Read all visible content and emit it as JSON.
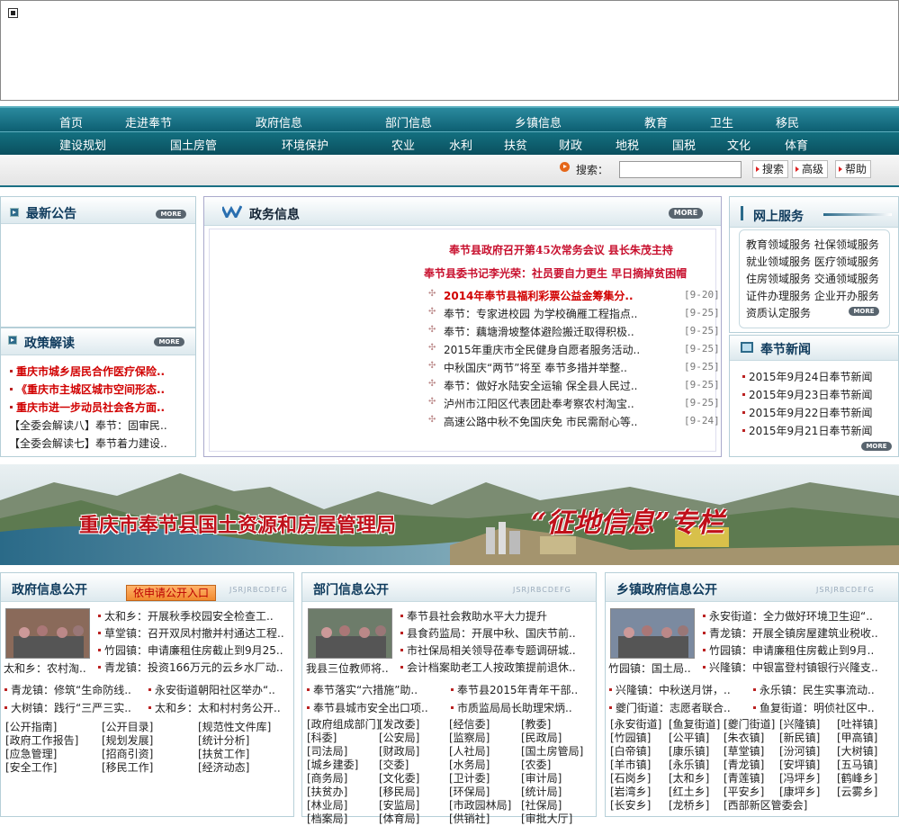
{
  "nav_primary": [
    "首页",
    "走进奉节",
    "政府信息",
    "部门信息",
    "乡镇信息",
    "教育",
    "卫生",
    "移民"
  ],
  "nav_secondary": [
    "建设规划",
    "国土房管",
    "环境保护",
    "农业",
    "水利",
    "扶贫",
    "财政",
    "地税",
    "国税",
    "文化",
    "体育"
  ],
  "search": {
    "label": "搜索：",
    "value": "",
    "buttons": [
      "搜索",
      "高级",
      "帮助"
    ]
  },
  "notice": {
    "title": "最新公告",
    "more": "MORE"
  },
  "policy": {
    "title": "政策解读",
    "more": "MORE",
    "items": [
      "重庆市城乡居民合作医疗保险..",
      "《重庆市主城区城市空间形态..",
      "重庆市进一步动员社会各方面..",
      "【全委会解读八】奉节：固审民..",
      "【全委会解读七】奉节着力建设.."
    ]
  },
  "gov": {
    "title": "政务信息",
    "more": "MORE",
    "headline1": "奉节县政府召开第45次常务会议  县长朱茂主持",
    "headline2": "奉节县委书记李光荣：社员要自力更生  早日摘掉贫困帽",
    "items": [
      {
        "t": "2014年奉节县福利彩票公益金筹集分..",
        "d": "[9-20]",
        "hot": true
      },
      {
        "t": "奉节：专家进校园 为学校确雁工程指点..",
        "d": "[9-25]"
      },
      {
        "t": "奉节：藕塘滑坡整体避险搬迁取得积极..",
        "d": "[9-25]"
      },
      {
        "t": "2015年重庆市全民健身自愿者服务活动..",
        "d": "[9-25]"
      },
      {
        "t": "中秋国庆“两节”将至 奉节多措并举整..",
        "d": "[9-25]"
      },
      {
        "t": "奉节：做好水陆安全运输 保全县人民过..",
        "d": "[9-25]"
      },
      {
        "t": "泸州市江阳区代表团赴奉考察农村淘宝..",
        "d": "[9-25]"
      },
      {
        "t": "高速公路中秋不免国庆免 市民需耐心等..",
        "d": "[9-24]"
      }
    ]
  },
  "online": {
    "title": "网上服务",
    "more": "MORE",
    "rows": [
      "教育领域服务 社保领域服务",
      "就业领域服务 医疗领域服务",
      "住房领域服务 交通领域服务",
      "证件办理服务 企业开办服务",
      "资质认定服务"
    ]
  },
  "news": {
    "title": "奉节新闻",
    "more": "MORE",
    "items": [
      "2015年9月24日奉节新闻",
      "2015年9月23日奉节新闻",
      "2015年9月22日奉节新闻",
      "2015年9月21日奉节新闻"
    ]
  },
  "banner": {
    "title": "重庆市奉节县国土资源和房屋管理局",
    "slogan": "“征地信息”专栏"
  },
  "pub1": {
    "title": "政府信息公开",
    "tab": "依申请公开入口",
    "wm": "JSRJRBCDEFG",
    "caption": "太和乡：农村淘..",
    "right": [
      "太和乡：开展秋季校园安全检查工..",
      "草堂镇：召开双凤村撤并村通达工程..",
      "竹园镇：申请廉租住房截止到9月25..",
      "青龙镇：投资166万元的云乡水厂动.."
    ],
    "row": [
      [
        "青龙镇：修筑“生命防线..",
        "永安街道朝阳社区举办“.."
      ],
      [
        "大树镇：践行“三严三实..",
        "太和乡：太和村村务公开.."
      ]
    ],
    "links": [
      "[公开指南]",
      "[公开目录]",
      "[规范性文件库]",
      "[政府工作报告]",
      "[规划发展]",
      "[统计分析]",
      "[应急管理]",
      "[招商引资]",
      "[扶贫工作]",
      "[安全工作]",
      "[移民工作]",
      "[经济动态]"
    ]
  },
  "pub2": {
    "title": "部门信息公开",
    "wm": "JSRJRBCDEFG",
    "caption": "我县三位教师将..",
    "right": [
      "奉节县社会救助水平大力提升",
      "县食药监局：开展中秋、国庆节前..",
      "市社保局相关领导莅奉专题调研城..",
      "会计档案助老工人按政策提前退休.."
    ],
    "row": [
      [
        "奉节落实“六措施”助..",
        "奉节县2015年青年干部.."
      ],
      [
        "奉节县城市安全出口项..",
        "市质监局局长助理宋炳.."
      ]
    ],
    "links": [
      "[政府组成部门]",
      "[发改委]",
      "[经信委]",
      "[教委]",
      "[科委]",
      "[公安局]",
      "[监察局]",
      "[民政局]",
      "[司法局]",
      "[财政局]",
      "[人社局]",
      "[国土房管局]",
      "[城乡建委]",
      "[交委]",
      "[水务局]",
      "[农委]",
      "[商务局]",
      "[文化委]",
      "[卫计委]",
      "[审计局]",
      "[扶贫办]",
      "[移民局]",
      "[环保局]",
      "[统计局]",
      "[林业局]",
      "[安监局]",
      "[市政园林局]",
      "[社保局]",
      "[档案局]",
      "[体育局]",
      "[供销社]",
      "[审批大厅]"
    ]
  },
  "pub3": {
    "title": "乡镇政府信息公开",
    "wm": "JSRJRBCDEFG",
    "caption": "竹园镇：国土局..",
    "right": [
      "永安街道：全力做好环境卫生迎“..",
      "青龙镇：开展全镇房屋建筑业税收..",
      "竹园镇：申请廉租住房截止到9月..",
      "兴隆镇：中银富登村镇银行兴隆支.."
    ],
    "row": [
      [
        "兴隆镇：中秋送月饼，..",
        "永乐镇：民生实事流动.."
      ],
      [
        "夔门街道：志愿者联合..",
        "鱼复街道：明侦社区中.."
      ]
    ],
    "links": [
      "[永安街道]",
      "[鱼复街道]",
      "[夔门街道]",
      "[兴隆镇]",
      "[吐祥镇]",
      "[竹园镇]",
      "[公平镇]",
      "[朱衣镇]",
      "[新民镇]",
      "[甲高镇]",
      "[白帝镇]",
      "[康乐镇]",
      "[草堂镇]",
      "[汾河镇]",
      "[大树镇]",
      "[羊市镇]",
      "[永乐镇]",
      "[青龙镇]",
      "[安坪镇]",
      "[五马镇]",
      "[石岗乡]",
      "[太和乡]",
      "[青莲镇]",
      "[冯坪乡]",
      "[鹤峰乡]",
      "[岩湾乡]",
      "[红土乡]",
      "[平安乡]",
      "[康坪乡]",
      "[云雾乡]",
      "[长安乡]",
      "[龙桥乡]",
      "[西部新区管委会]"
    ]
  },
  "colors": {
    "nav": "#0d5f72",
    "title": "#0e3a5c",
    "hot": "#d10000"
  }
}
